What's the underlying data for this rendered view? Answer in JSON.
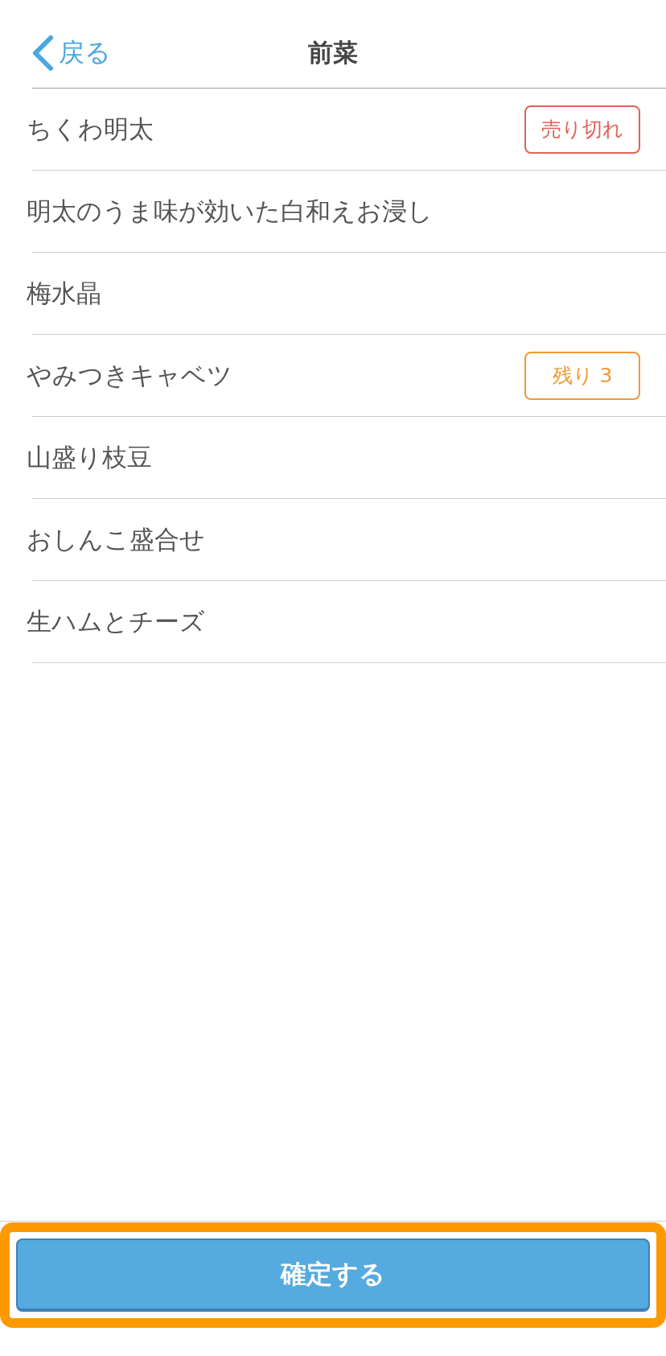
{
  "header": {
    "back": {
      "label": "戻る"
    },
    "title": "前菜"
  },
  "items": [
    {
      "name": "ちくわ明太",
      "badge": {
        "kind": "sold_out",
        "label": "売り切れ"
      }
    },
    {
      "name": "明太のうま味が効いた白和えお浸し"
    },
    {
      "name": "梅水晶"
    },
    {
      "name": "やみつきキャベツ",
      "badge": {
        "kind": "remaining",
        "label": "残り 3"
      }
    },
    {
      "name": "山盛り枝豆"
    },
    {
      "name": "おしんこ盛合せ"
    },
    {
      "name": "生ハムとチーズ"
    }
  ],
  "confirm_button": {
    "label": "確定する",
    "highlighted": true
  }
}
